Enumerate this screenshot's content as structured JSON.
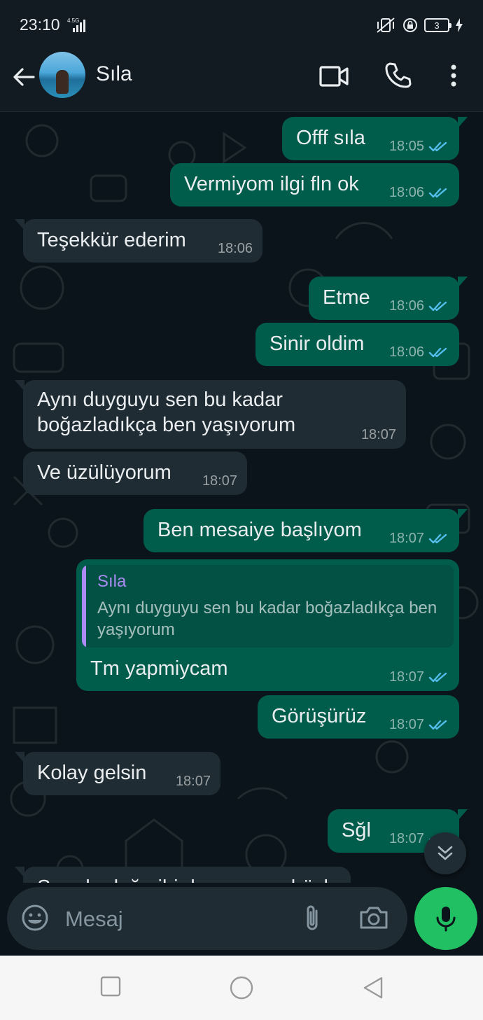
{
  "status_bar": {
    "time": "23:10",
    "network": "4.5G",
    "battery": "3"
  },
  "header": {
    "contact_name": "Sıla"
  },
  "messages": [
    {
      "dir": "out",
      "text": "Offf sıla",
      "time": "18:05"
    },
    {
      "dir": "out",
      "text": "Vermiyom ilgi fln ok",
      "time": "18:06"
    },
    {
      "dir": "in",
      "text": "Teşekkür ederim",
      "time": "18:06"
    },
    {
      "dir": "out",
      "text": "Etme",
      "time": "18:06"
    },
    {
      "dir": "out",
      "text": "Sinir oldim",
      "time": "18:06"
    },
    {
      "dir": "in",
      "text_line1": "Aynı duyguyu sen bu kadar",
      "text_line2": "boğazladıkça ben yaşıyorum",
      "time": "18:07"
    },
    {
      "dir": "in",
      "text": "Ve üzülüyorum",
      "time": "18:07"
    },
    {
      "dir": "out",
      "text": "Ben mesaiye başlıyom",
      "time": "18:07"
    },
    {
      "dir": "out",
      "quote_name": "Sıla",
      "quote_text": "Aynı duyguyu sen bu kadar boğazladıkça ben yaşıyorum",
      "text": "Tm yapmiycam",
      "time": "18:07"
    },
    {
      "dir": "out",
      "text": "Görüşürüz",
      "time": "18:07"
    },
    {
      "dir": "in",
      "text": "Kolay gelsin",
      "time": "18:07"
    },
    {
      "dir": "out",
      "text": "Sğl",
      "time": "18:07"
    },
    {
      "dir": "in",
      "text": "Sen de dağ gibi duruyorsun böyle",
      "time": ""
    }
  ],
  "composer": {
    "placeholder": "Mesaj"
  },
  "colors": {
    "outgoing": "#005c4b",
    "incoming": "#202c33",
    "background": "#0b141a",
    "read_ticks": "#53bdeb",
    "mic_button": "#21c063"
  },
  "icons": [
    "back-arrow-icon",
    "video-call-icon",
    "phone-icon",
    "more-options-icon",
    "double-check-icon",
    "chevron-double-down-icon",
    "emoji-icon",
    "paperclip-icon",
    "camera-icon",
    "mic-icon",
    "recent-apps-icon",
    "home-icon",
    "back-nav-icon"
  ]
}
